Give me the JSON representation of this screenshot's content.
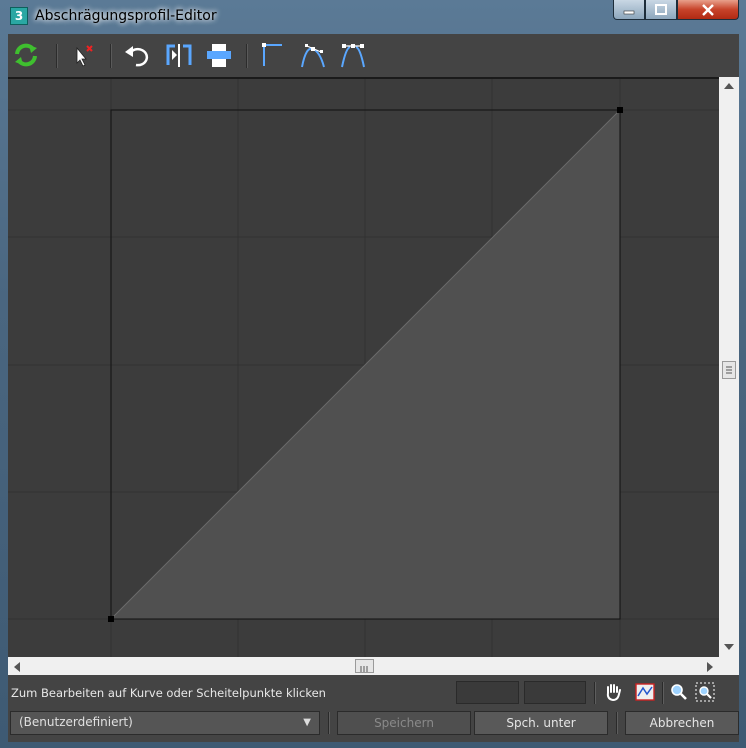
{
  "window": {
    "title": "Abschrägungsprofil-Editor",
    "app_icon_letter": "3"
  },
  "toolbar": {
    "icons": [
      "refresh-icon",
      "delete-point-icon",
      "undo-icon",
      "mirror-icon",
      "print-icon",
      "corner-point-icon",
      "bezier-smooth-icon",
      "bezier-corner-icon"
    ]
  },
  "status": {
    "message": "Zum Bearbeiten auf Kurve oder Scheitelpunkte klicken",
    "field_x": "",
    "field_y": ""
  },
  "bottom": {
    "preset_value": "(Benutzerdefiniert)",
    "save_label": "Speichern",
    "save_as_label": "Spch. unter",
    "cancel_label": "Abbrechen"
  },
  "colors": {
    "canvas_bg": "#3c3c3c",
    "profile_fill": "#505050",
    "grid": "#333333"
  }
}
